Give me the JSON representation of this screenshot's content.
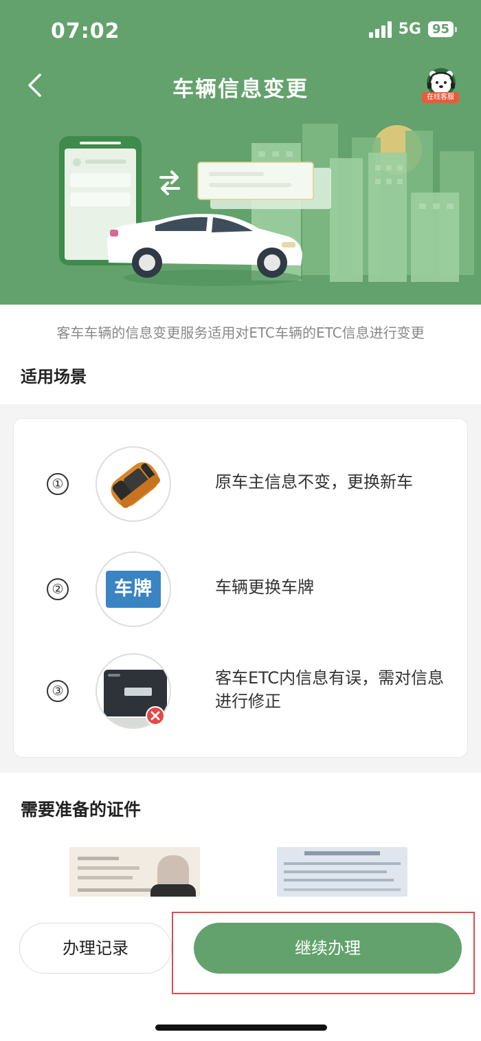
{
  "status_bar": {
    "time": "07:02",
    "network": "5G",
    "battery": "95"
  },
  "header": {
    "title": "车辆信息变更",
    "service_label": "在线客服"
  },
  "intro": "客车车辆的信息变更服务适用对ETC车辆的ETC信息进行变更",
  "scenarios": {
    "title": "适用场景",
    "items": [
      {
        "number": "①",
        "text": "原车主信息不变，更换新车"
      },
      {
        "number": "②",
        "text": "车辆更换车牌",
        "badge": "车牌"
      },
      {
        "number": "③",
        "text": "客车ETC内信息有误，需对信息进行修正"
      }
    ]
  },
  "documents": {
    "title": "需要准备的证件"
  },
  "actions": {
    "record_label": "办理记录",
    "continue_label": "继续办理"
  },
  "colors": {
    "brand_green": "#63a26c",
    "highlight_red": "#e24a4a",
    "service_red": "#e95a3d"
  },
  "icons": [
    "back-arrow-icon",
    "customer-service-icon",
    "swap-arrows-icon",
    "signal-icon",
    "battery-icon",
    "error-icon"
  ]
}
